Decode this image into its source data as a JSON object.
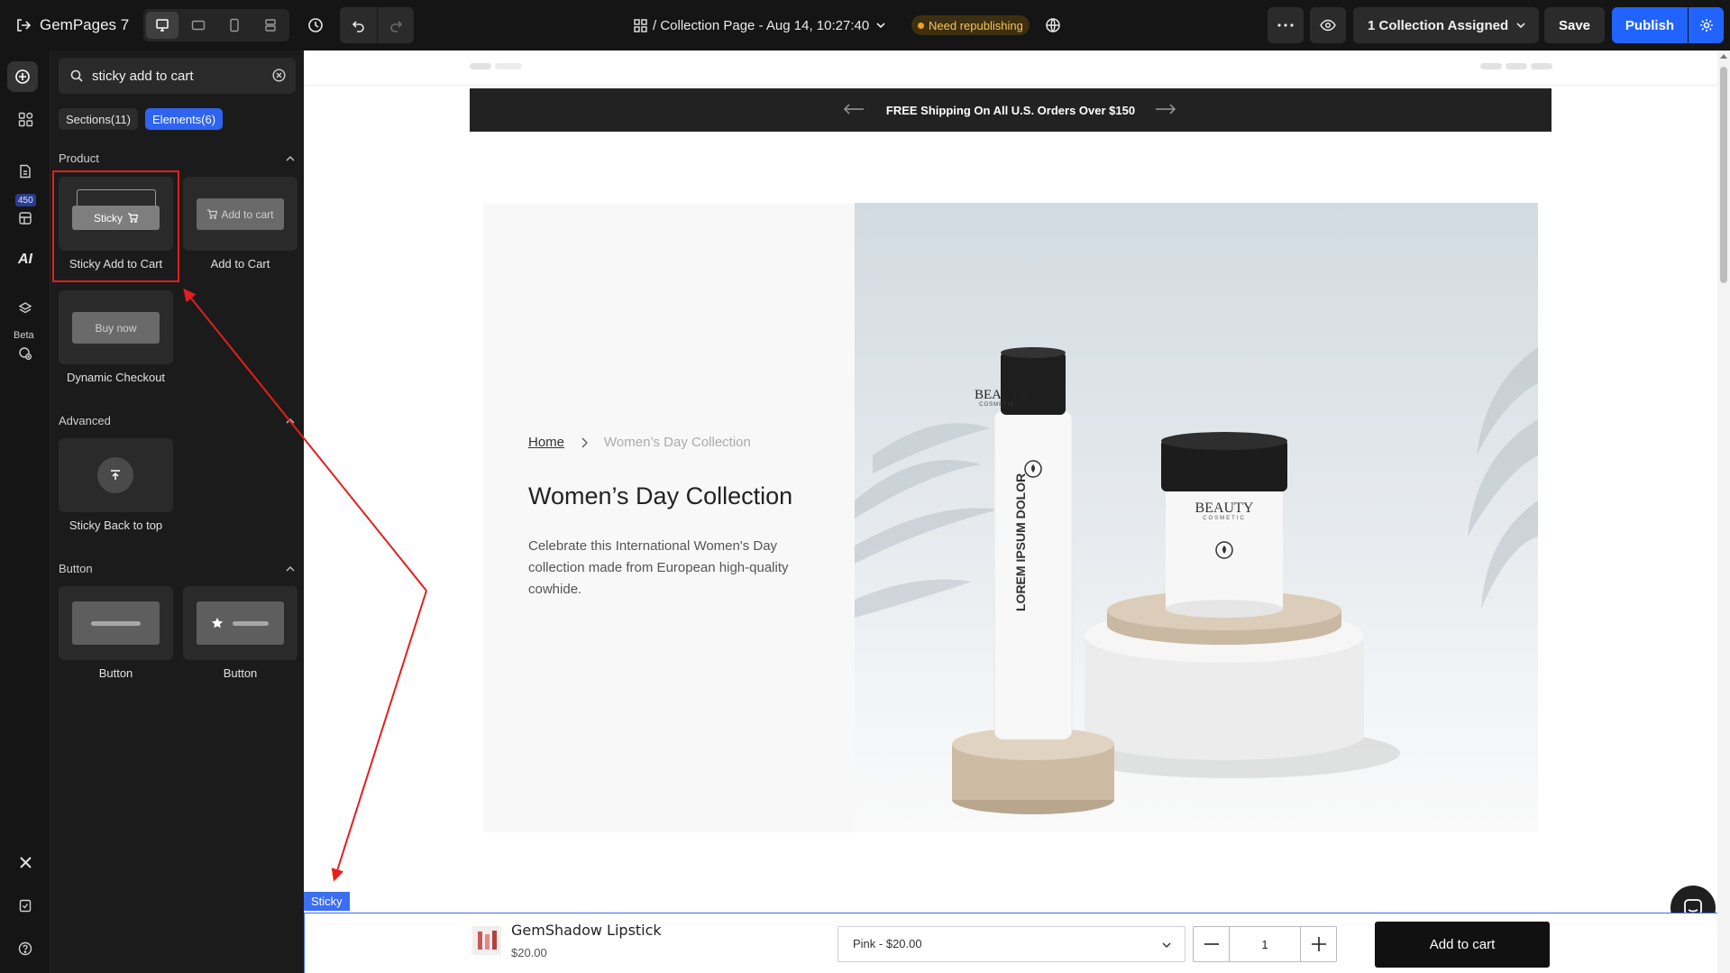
{
  "topbar": {
    "logo": "GemPages 7",
    "page_title": "/ Collection Page - Aug 14, 10:27:40",
    "status_badge": "Need republishing",
    "assigned_label": "1 Collection Assigned",
    "save_label": "Save",
    "publish_label": "Publish",
    "accent_color": "#2163ff"
  },
  "rail": {
    "badge_count": "450",
    "ai_label": "AI",
    "beta_label": "Beta"
  },
  "panel": {
    "search": {
      "value": "sticky add to cart"
    },
    "tabs": [
      {
        "label": "Sections(11)",
        "active": false
      },
      {
        "label": "Elements(6)",
        "active": true
      }
    ],
    "sections": {
      "product": {
        "title": "Product",
        "items": [
          {
            "label": "Sticky Add to Cart",
            "preview": "Sticky"
          },
          {
            "label": "Add to Cart",
            "preview": "Add to cart"
          },
          {
            "label": "Dynamic Checkout",
            "preview": "Buy now"
          }
        ]
      },
      "advanced": {
        "title": "Advanced",
        "items": [
          {
            "label": "Sticky Back to top"
          }
        ]
      },
      "button": {
        "title": "Button",
        "items": [
          {
            "label": "Button"
          },
          {
            "label": "Button"
          }
        ]
      }
    }
  },
  "canvas": {
    "announcement": "FREE Shipping On All U.S. Orders Over $150",
    "breadcrumb": {
      "home": "Home",
      "current": "Women’s Day Collection"
    },
    "hero": {
      "title": "Women’s Day Collection",
      "description": "Celebrate this International Women's Day collection made from European high-quality cowhide."
    },
    "product_image": {
      "bottle_brand": "BEAUTY",
      "bottle_sub": "COSMETIC",
      "bottle_text": "LOREM IPSUM DOLOR",
      "jar_brand": "BEAUTY",
      "jar_sub": "COSMETIC"
    },
    "sticky": {
      "tag": "Sticky",
      "product_name": "GemShadow Lipstick",
      "price": "$20.00",
      "variant": "Pink - $20.00",
      "quantity": "1",
      "add_to_cart": "Add to cart"
    }
  }
}
